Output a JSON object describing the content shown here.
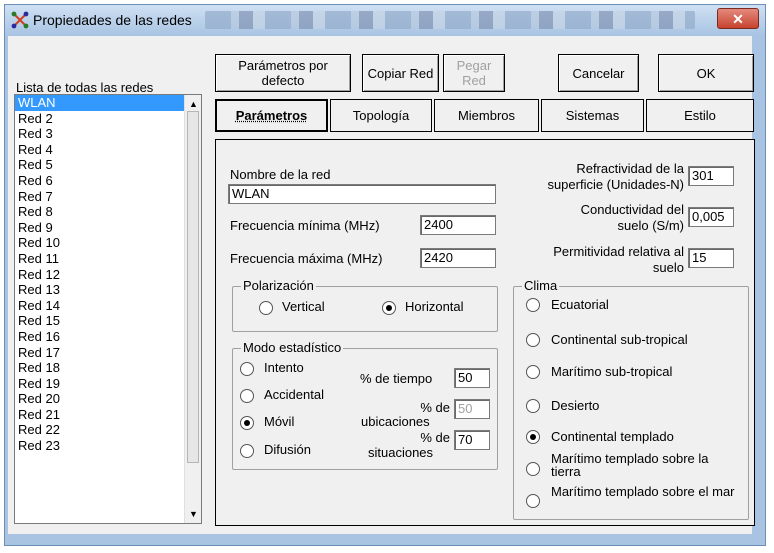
{
  "window": {
    "title": "Propiedades de las redes",
    "close_glyph": "✕"
  },
  "buttons": {
    "default_params": "Parámetros por defecto",
    "copy_network": "Copiar Red",
    "paste_network": "Pegar Red",
    "cancel": "Cancelar",
    "ok": "OK"
  },
  "network_list": {
    "label": "Lista de todas las redes",
    "selected": "WLAN",
    "items": [
      "WLAN",
      "Red 2",
      "Red 3",
      "Red 4",
      "Red 5",
      "Red 6",
      "Red 7",
      "Red 8",
      "Red 9",
      "Red 10",
      "Red 11",
      "Red 12",
      "Red 13",
      "Red 14",
      "Red 15",
      "Red 16",
      "Red 17",
      "Red 18",
      "Red 19",
      "Red 20",
      "Red 21",
      "Red 22",
      "Red 23"
    ]
  },
  "tabs": [
    {
      "label": "Parámetros",
      "active": true
    },
    {
      "label": "Topología",
      "active": false
    },
    {
      "label": "Miembros",
      "active": false
    },
    {
      "label": "Sistemas",
      "active": false
    },
    {
      "label": "Estilo",
      "active": false
    }
  ],
  "params": {
    "network_name_label": "Nombre de la red",
    "network_name_value": "WLAN",
    "min_freq_label": "Frecuencia mínima (MHz)",
    "min_freq_value": "2400",
    "max_freq_label": "Frecuencia máxima (MHz)",
    "max_freq_value": "2420",
    "refractivity_label_1": "Refractividad de la",
    "refractivity_label_2": "superficie (Unidades-N)",
    "refractivity_value": "301",
    "conductivity_label_1": "Conductividad del",
    "conductivity_label_2": "suelo (S/m)",
    "conductivity_value": "0,005",
    "permittivity_label_1": "Permitividad relativa al",
    "permittivity_label_2": "suelo",
    "permittivity_value": "15"
  },
  "polarization": {
    "title": "Polarización",
    "options": [
      "Vertical",
      "Horizontal"
    ],
    "selected": "Horizontal"
  },
  "statistical_mode": {
    "title": "Modo estadístico",
    "options": [
      "Intento",
      "Accidental",
      "Móvil",
      "Difusión"
    ],
    "selected": "Móvil",
    "time_label": "% de tiempo",
    "time_value": "50",
    "locations_label_1": "% de",
    "locations_label_2": "ubicaciones",
    "locations_value": "50",
    "situations_label_1": "% de",
    "situations_label_2": "situaciones",
    "situations_value": "70"
  },
  "climate": {
    "title": "Clima",
    "options": [
      "Ecuatorial",
      "Continental sub-tropical",
      "Marítimo sub-tropical",
      "Desierto",
      "Continental templado",
      "Marítimo templado sobre la tierra",
      "Marítimo templado sobre el mar"
    ],
    "selected": "Continental templado"
  },
  "colors": {
    "selection": "#3399ff",
    "frame": "#a9c4e3",
    "close": "#c8432f"
  }
}
